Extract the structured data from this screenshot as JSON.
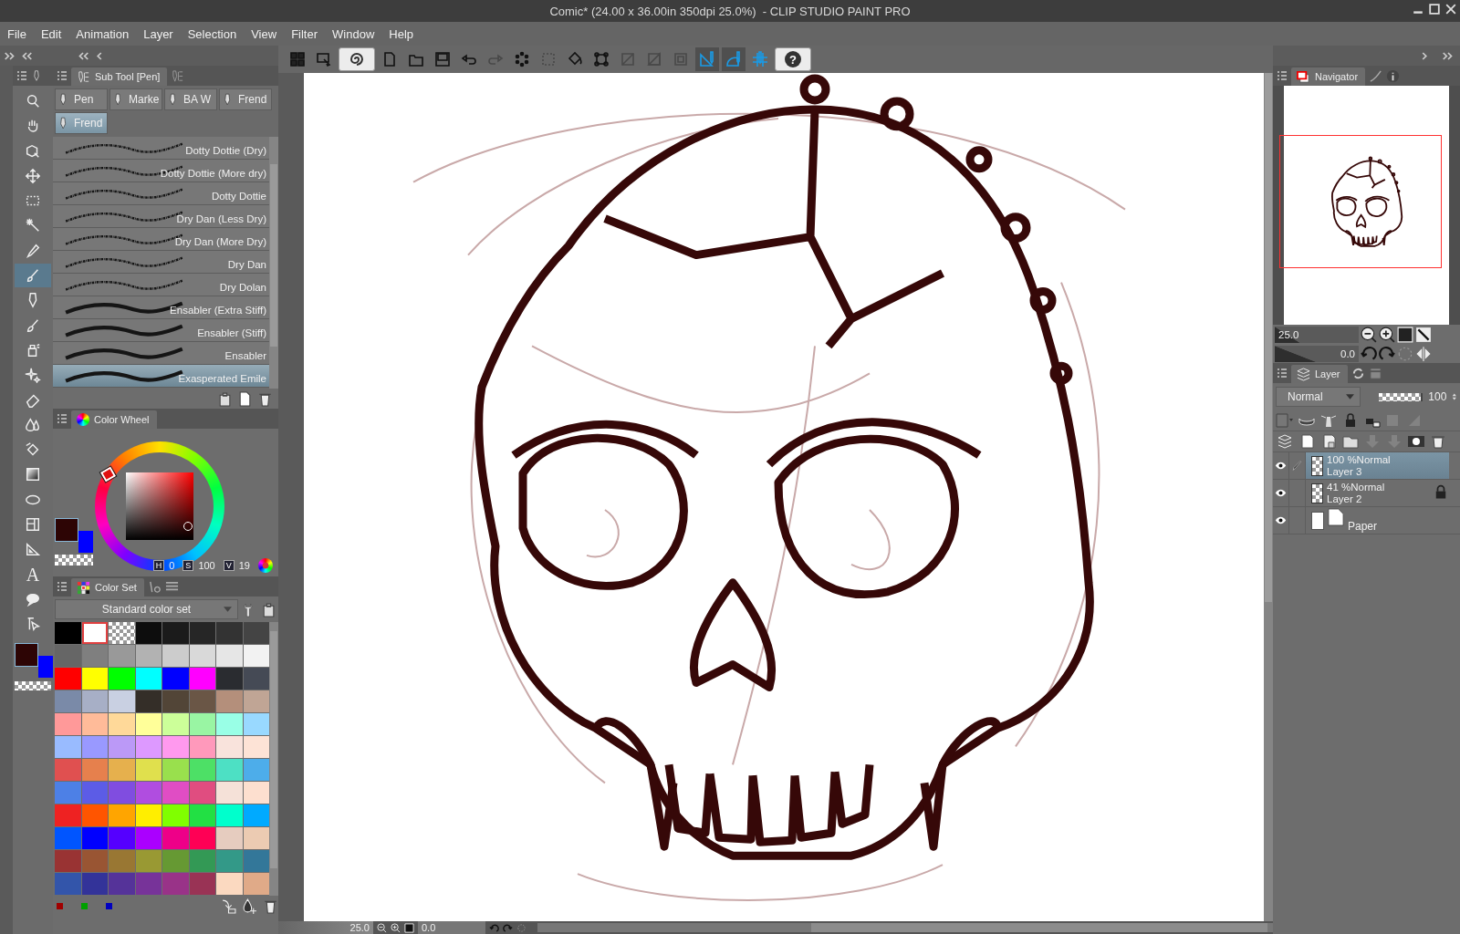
{
  "window": {
    "title": "Comic* (24.00 x 36.00in 350dpi 25.0%)  - CLIP STUDIO PAINT PRO"
  },
  "menu": [
    "File",
    "Edit",
    "Animation",
    "Layer",
    "Selection",
    "View",
    "Filter",
    "Window",
    "Help"
  ],
  "toolbar": [
    {
      "kind": "grid",
      "disabled": false,
      "on": false
    },
    {
      "kind": "screen",
      "disabled": false,
      "on": false
    },
    {
      "kind": "logo",
      "disabled": false,
      "on": false
    },
    {
      "kind": "new",
      "disabled": false,
      "on": false
    },
    {
      "kind": "open",
      "disabled": false,
      "on": false
    },
    {
      "kind": "save",
      "disabled": false,
      "on": false
    },
    {
      "kind": "undo",
      "disabled": false,
      "on": false
    },
    {
      "kind": "redo",
      "disabled": true,
      "on": false
    },
    {
      "kind": "dots",
      "disabled": false,
      "on": false
    },
    {
      "kind": "crop",
      "disabled": true,
      "on": false
    },
    {
      "kind": "fill",
      "disabled": false,
      "on": false
    },
    {
      "kind": "transform",
      "disabled": false,
      "on": false
    },
    {
      "kind": "slash",
      "disabled": true,
      "on": false
    },
    {
      "kind": "half",
      "disabled": true,
      "on": false
    },
    {
      "kind": "dotted",
      "disabled": true,
      "on": false
    },
    {
      "kind": "snap_ruler",
      "disabled": false,
      "on": true
    },
    {
      "kind": "snap_special",
      "disabled": false,
      "on": true
    },
    {
      "kind": "snap_grid",
      "disabled": false,
      "on": false
    },
    {
      "kind": "help",
      "label": "?",
      "disabled": false,
      "on": false
    }
  ],
  "tools": [
    {
      "selected": false
    },
    {
      "selected": false
    },
    {
      "selected": false
    },
    {
      "selected": false
    },
    {
      "selected": false
    },
    {
      "selected": false
    },
    {
      "selected": false
    },
    {
      "selected": true
    },
    {
      "selected": false
    },
    {
      "selected": false
    },
    {
      "selected": false
    },
    {
      "selected": false
    },
    {
      "selected": false
    },
    {
      "selected": false
    },
    {
      "selected": false
    },
    {
      "selected": false
    },
    {
      "selected": false
    },
    {
      "selected": false
    },
    {
      "selected": false
    },
    {
      "selected": false,
      "glyph": "A"
    },
    {
      "selected": false
    },
    {
      "selected": false
    }
  ],
  "sub_tool": {
    "title": "Sub Tool [Pen]",
    "tabs": [
      {
        "label": "Pen",
        "selected": false
      },
      {
        "label": "Marke",
        "selected": false
      },
      {
        "label": "BA W",
        "selected": false
      },
      {
        "label": "Frend",
        "selected": false
      },
      {
        "label": "Frend",
        "selected": true
      }
    ],
    "brushes": [
      {
        "name": "Dotty Dottie (Dry)",
        "selected": false
      },
      {
        "name": "Dotty Dottie (More dry)",
        "selected": false
      },
      {
        "name": "Dotty Dottie",
        "selected": false
      },
      {
        "name": "Dry Dan (Less Dry)",
        "selected": false
      },
      {
        "name": "Dry Dan (More Dry)",
        "selected": false
      },
      {
        "name": "Dry Dan",
        "selected": false
      },
      {
        "name": "Dry Dolan",
        "selected": false
      },
      {
        "name": "Ensabler (Extra Stiff)",
        "selected": false
      },
      {
        "name": "Ensabler (Stiff)",
        "selected": false
      },
      {
        "name": "Ensabler",
        "selected": false
      },
      {
        "name": "Exasperated Emile",
        "selected": true
      }
    ]
  },
  "color_wheel": {
    "title": "Color Wheel",
    "h_label": "H",
    "h": "0",
    "s_label": "S",
    "s": "100",
    "v_label": "V",
    "v": "19"
  },
  "color_set": {
    "title": "Color Set",
    "set_name": "Standard color set",
    "swatch_rows": [
      [
        {
          "kind": "color",
          "color": "#000000",
          "selected": false
        },
        {
          "kind": "color",
          "color": "#ffffff",
          "selected": true
        },
        {
          "kind": "transparent",
          "selected": false
        },
        {
          "kind": "color",
          "color": "#0d0d0d",
          "selected": false
        },
        {
          "kind": "color",
          "color": "#1b1b1b",
          "selected": false
        },
        {
          "kind": "color",
          "color": "#262626",
          "selected": false
        },
        {
          "kind": "color",
          "color": "#333333",
          "selected": false
        },
        {
          "kind": "color",
          "color": "#444444",
          "selected": false
        }
      ],
      [
        {
          "kind": "color",
          "color": "#666666",
          "selected": false
        },
        {
          "kind": "color",
          "color": "#7f7f7f",
          "selected": false
        },
        {
          "kind": "color",
          "color": "#999999",
          "selected": false
        },
        {
          "kind": "color",
          "color": "#b2b2b2",
          "selected": false
        },
        {
          "kind": "color",
          "color": "#cccccc",
          "selected": false
        },
        {
          "kind": "color",
          "color": "#d9d9d9",
          "selected": false
        },
        {
          "kind": "color",
          "color": "#e6e6e6",
          "selected": false
        },
        {
          "kind": "color",
          "color": "#f2f2f2",
          "selected": false
        }
      ],
      [
        {
          "kind": "color",
          "color": "#ff0000",
          "selected": false
        },
        {
          "kind": "color",
          "color": "#ffff00",
          "selected": false
        },
        {
          "kind": "color",
          "color": "#00ff00",
          "selected": false
        },
        {
          "kind": "color",
          "color": "#00ffff",
          "selected": false
        },
        {
          "kind": "color",
          "color": "#0000ff",
          "selected": false
        },
        {
          "kind": "color",
          "color": "#ff00ff",
          "selected": false
        },
        {
          "kind": "color",
          "color": "#2a2c30",
          "selected": false
        },
        {
          "kind": "color",
          "color": "#454a55",
          "selected": false
        }
      ],
      [
        {
          "kind": "color",
          "color": "#7a8aa8",
          "selected": false
        },
        {
          "kind": "color",
          "color": "#a7afc6",
          "selected": false
        },
        {
          "kind": "color",
          "color": "#c9d0e2",
          "selected": false
        },
        {
          "kind": "color",
          "color": "#342e28",
          "selected": false
        },
        {
          "kind": "color",
          "color": "#524537",
          "selected": false
        },
        {
          "kind": "color",
          "color": "#6a5646",
          "selected": false
        },
        {
          "kind": "color",
          "color": "#b48f7b",
          "selected": false
        },
        {
          "kind": "color",
          "color": "#c0a595",
          "selected": false
        }
      ],
      [
        {
          "kind": "color",
          "color": "#ff9999",
          "selected": false
        },
        {
          "kind": "color",
          "color": "#ffbb99",
          "selected": false
        },
        {
          "kind": "color",
          "color": "#ffd999",
          "selected": false
        },
        {
          "kind": "color",
          "color": "#ffff99",
          "selected": false
        },
        {
          "kind": "color",
          "color": "#ccff99",
          "selected": false
        },
        {
          "kind": "color",
          "color": "#99f5a3",
          "selected": false
        },
        {
          "kind": "color",
          "color": "#99ffe6",
          "selected": false
        },
        {
          "kind": "color",
          "color": "#99d9ff",
          "selected": false
        }
      ],
      [
        {
          "kind": "color",
          "color": "#99bbff",
          "selected": false
        },
        {
          "kind": "color",
          "color": "#9999ff",
          "selected": false
        },
        {
          "kind": "color",
          "color": "#bb99f7",
          "selected": false
        },
        {
          "kind": "color",
          "color": "#dd99ff",
          "selected": false
        },
        {
          "kind": "color",
          "color": "#ff99ee",
          "selected": false
        },
        {
          "kind": "color",
          "color": "#ff99bb",
          "selected": false
        },
        {
          "kind": "color",
          "color": "#f9e3dc",
          "selected": false
        },
        {
          "kind": "color",
          "color": "#fde3d6",
          "selected": false
        }
      ],
      [
        {
          "kind": "color",
          "color": "#e05050",
          "selected": false
        },
        {
          "kind": "color",
          "color": "#e6804d",
          "selected": false
        },
        {
          "kind": "color",
          "color": "#e6b04d",
          "selected": false
        },
        {
          "kind": "color",
          "color": "#e0e04d",
          "selected": false
        },
        {
          "kind": "color",
          "color": "#99e04d",
          "selected": false
        },
        {
          "kind": "color",
          "color": "#4de066",
          "selected": false
        },
        {
          "kind": "color",
          "color": "#4de0c4",
          "selected": false
        },
        {
          "kind": "color",
          "color": "#4dadea",
          "selected": false
        }
      ],
      [
        {
          "kind": "color",
          "color": "#4d80e6",
          "selected": false
        },
        {
          "kind": "color",
          "color": "#5c5ce6",
          "selected": false
        },
        {
          "kind": "color",
          "color": "#804de0",
          "selected": false
        },
        {
          "kind": "color",
          "color": "#b04de0",
          "selected": false
        },
        {
          "kind": "color",
          "color": "#e04dc4",
          "selected": false
        },
        {
          "kind": "color",
          "color": "#e04d80",
          "selected": false
        },
        {
          "kind": "color",
          "color": "#f5e1d8",
          "selected": false
        },
        {
          "kind": "color",
          "color": "#fddfcf",
          "selected": false
        }
      ],
      [
        {
          "kind": "color",
          "color": "#ee2222",
          "selected": false
        },
        {
          "kind": "color",
          "color": "#ff5500",
          "selected": false
        },
        {
          "kind": "color",
          "color": "#ffa500",
          "selected": false
        },
        {
          "kind": "color",
          "color": "#ffee00",
          "selected": false
        },
        {
          "kind": "color",
          "color": "#80ff00",
          "selected": false
        },
        {
          "kind": "color",
          "color": "#22e044",
          "selected": false
        },
        {
          "kind": "color",
          "color": "#00ffcc",
          "selected": false
        },
        {
          "kind": "color",
          "color": "#00aaff",
          "selected": false
        }
      ],
      [
        {
          "kind": "color",
          "color": "#0055ff",
          "selected": false
        },
        {
          "kind": "color",
          "color": "#0000ff",
          "selected": false
        },
        {
          "kind": "color",
          "color": "#5500ff",
          "selected": false
        },
        {
          "kind": "color",
          "color": "#aa00ff",
          "selected": false
        },
        {
          "kind": "color",
          "color": "#ee0088",
          "selected": false
        },
        {
          "kind": "color",
          "color": "#ff0055",
          "selected": false
        },
        {
          "kind": "color",
          "color": "#e6ccbf",
          "selected": false
        },
        {
          "kind": "color",
          "color": "#eccbb2",
          "selected": false
        }
      ],
      [
        {
          "kind": "color",
          "color": "#993333",
          "selected": false
        },
        {
          "kind": "color",
          "color": "#995533",
          "selected": false
        },
        {
          "kind": "color",
          "color": "#997733",
          "selected": false
        },
        {
          "kind": "color",
          "color": "#999933",
          "selected": false
        },
        {
          "kind": "color",
          "color": "#669933",
          "selected": false
        },
        {
          "kind": "color",
          "color": "#339955",
          "selected": false
        },
        {
          "kind": "color",
          "color": "#339988",
          "selected": false
        },
        {
          "kind": "color",
          "color": "#337799",
          "selected": false
        }
      ],
      [
        {
          "kind": "color",
          "color": "#3355aa",
          "selected": false
        },
        {
          "kind": "color",
          "color": "#333399",
          "selected": false
        },
        {
          "kind": "color",
          "color": "#553399",
          "selected": false
        },
        {
          "kind": "color",
          "color": "#773399",
          "selected": false
        },
        {
          "kind": "color",
          "color": "#993388",
          "selected": false
        },
        {
          "kind": "color",
          "color": "#993355",
          "selected": false
        },
        {
          "kind": "color",
          "color": "#fbd9c0",
          "selected": false
        },
        {
          "kind": "color",
          "color": "#e0aa88",
          "selected": false
        }
      ]
    ]
  },
  "navigator": {
    "title": "Navigator",
    "zoom": "25.0",
    "zoom_slider": {
      "level": 0.3
    },
    "angle": "0.0",
    "rotation_slider": {
      "level": 0.5
    }
  },
  "layer_panel": {
    "title": "Layer",
    "blend_mode": "Normal",
    "opacity_slider": {
      "level": 1
    },
    "opacity": "100",
    "layers": [
      {
        "kind": "raster",
        "opacity": "100 %",
        "mode": "Normal",
        "name": "Layer 3",
        "selected": true,
        "visible": true,
        "editing": true,
        "locked": false
      },
      {
        "kind": "raster",
        "opacity": "41 %",
        "mode": "Normal",
        "name": "Layer 2",
        "selected": false,
        "visible": true,
        "editing": false,
        "locked": true
      },
      {
        "kind": "paper",
        "name": "Paper",
        "selected": false,
        "visible": true,
        "editing": false,
        "locked": false
      }
    ]
  },
  "status_bar": {
    "zoom": "25.0",
    "angle": "0.0"
  }
}
